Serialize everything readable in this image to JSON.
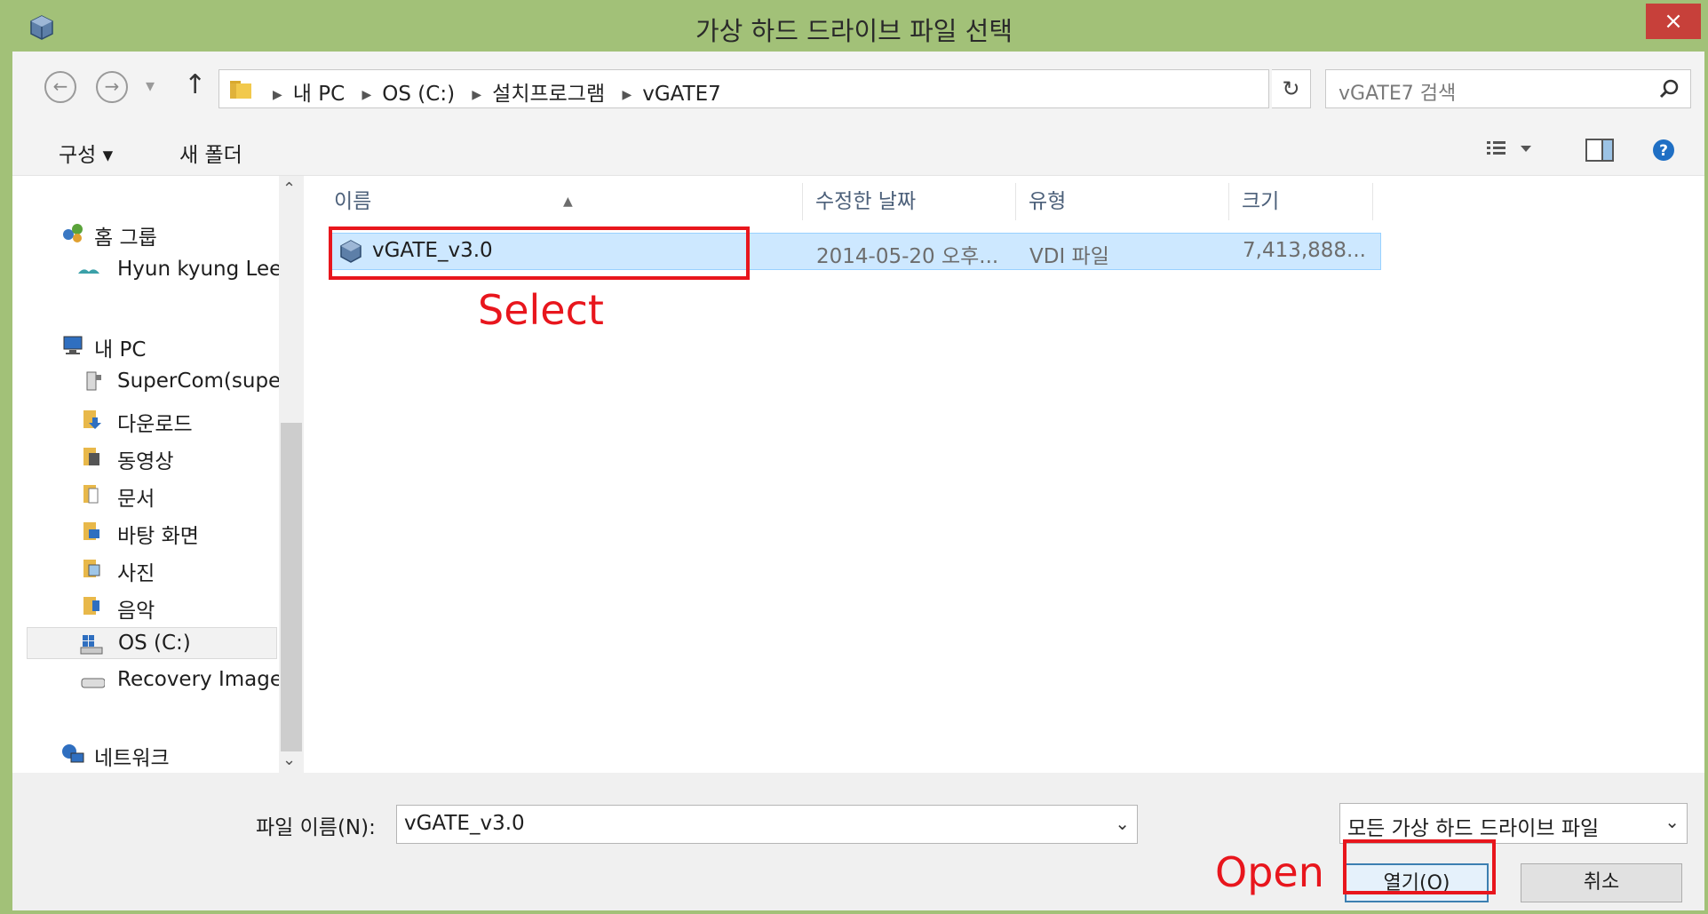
{
  "window": {
    "title": "가상 하드 드라이브 파일 선택",
    "close_label": "×"
  },
  "address": {
    "crumbs": [
      "내 PC",
      "OS (C:)",
      "설치프로그램",
      "vGATE7"
    ],
    "search_placeholder": "vGATE7 검색"
  },
  "toolbar": {
    "organize_label": "구성 ▾",
    "new_folder_label": "새 폴더"
  },
  "nav": {
    "items": [
      {
        "label": "홈 그룹",
        "icon": "homegroup-icon"
      },
      {
        "label": "Hyun kyung Lee",
        "icon": "user-icon"
      },
      {
        "label": "내 PC",
        "icon": "computer-icon"
      },
      {
        "label": "SuperCom(super",
        "icon": "network-drive-icon"
      },
      {
        "label": "다운로드",
        "icon": "downloads-folder-icon"
      },
      {
        "label": "동영상",
        "icon": "videos-folder-icon"
      },
      {
        "label": "문서",
        "icon": "documents-folder-icon"
      },
      {
        "label": "바탕 화면",
        "icon": "desktop-folder-icon"
      },
      {
        "label": "사진",
        "icon": "pictures-folder-icon"
      },
      {
        "label": "음악",
        "icon": "music-folder-icon"
      },
      {
        "label": "OS (C:)",
        "icon": "drive-icon"
      },
      {
        "label": "Recovery Image",
        "icon": "drive-icon"
      },
      {
        "label": "네트워크",
        "icon": "network-icon"
      }
    ]
  },
  "filelist": {
    "columns": [
      "이름",
      "수정한 날짜",
      "유형",
      "크기"
    ],
    "rows": [
      {
        "name": "vGATE_v3.0",
        "modified": "2014-05-20 오후...",
        "type": "VDI 파일",
        "size": "7,413,888..."
      }
    ]
  },
  "bottom": {
    "filename_label": "파일 이름(N):",
    "filename_value": "vGATE_v3.0",
    "filter_value": "모든 가상 하드 드라이브 파일",
    "open_label": "열기(O)",
    "cancel_label": "취소"
  },
  "annotations": {
    "select_text": "Select",
    "open_text": "Open"
  },
  "colors": {
    "titlebar": "#a2c178",
    "selection": "#cde8ff",
    "annotation": "#e8161d"
  }
}
